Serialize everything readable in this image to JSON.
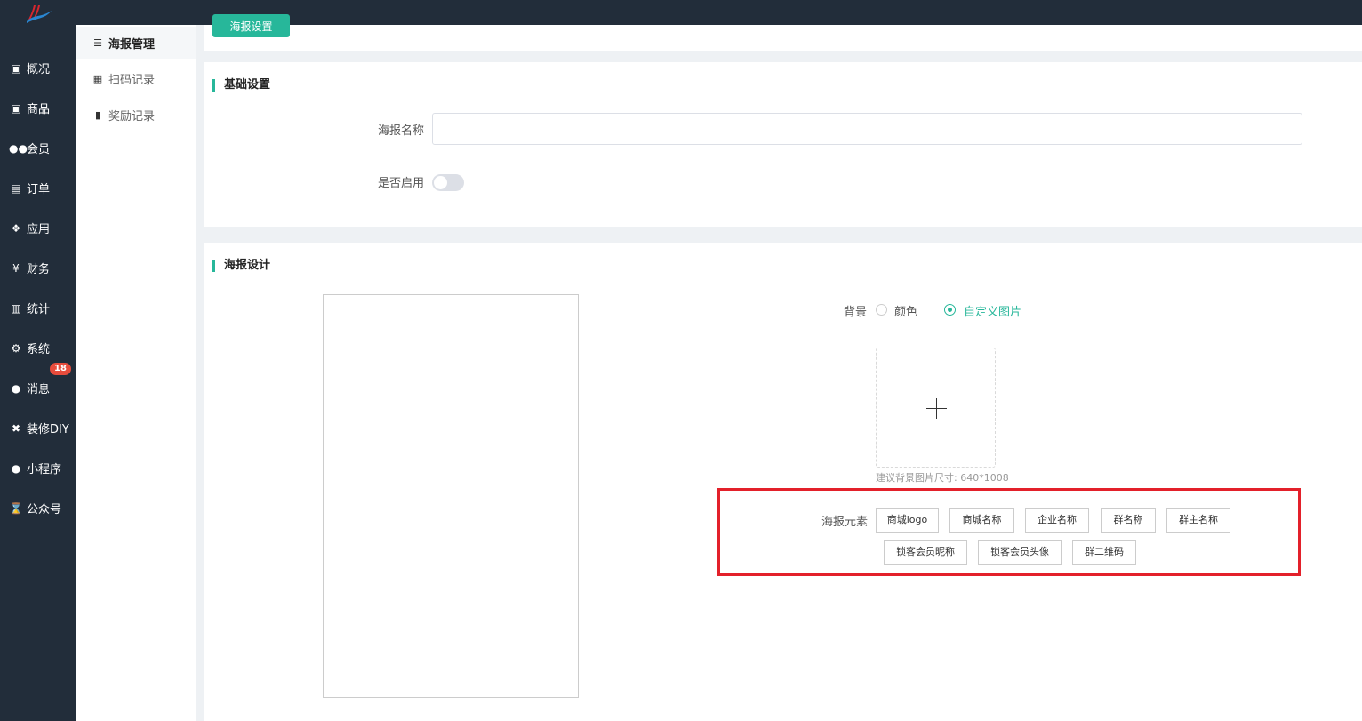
{
  "sidebar": {
    "items": [
      {
        "label": "概况",
        "icon": "archive-icon"
      },
      {
        "label": "商品",
        "icon": "archive-icon"
      },
      {
        "label": "会员",
        "icon": "users-icon"
      },
      {
        "label": "订单",
        "icon": "cart-icon"
      },
      {
        "label": "应用",
        "icon": "cubes-icon"
      },
      {
        "label": "财务",
        "icon": "yen-icon"
      },
      {
        "label": "统计",
        "icon": "bar-chart-icon"
      },
      {
        "label": "系统",
        "icon": "gears-icon"
      },
      {
        "label": "消息",
        "icon": "comment-icon",
        "badge": "18"
      },
      {
        "label": "装修DIY",
        "icon": "gavel-icon"
      },
      {
        "label": "小程序",
        "icon": "wechat-icon"
      },
      {
        "label": "公众号",
        "icon": "hourglass-icon"
      }
    ]
  },
  "subnav": {
    "items": [
      {
        "label": "海报管理",
        "icon": "list-icon",
        "active": true
      },
      {
        "label": "扫码记录",
        "icon": "qrcode-icon"
      },
      {
        "label": "奖励记录",
        "icon": "bookmark-icon"
      }
    ]
  },
  "top_button": "海报设置",
  "basic": {
    "title": "基础设置",
    "name_label": "海报名称",
    "name_value": "",
    "enable_label": "是否启用"
  },
  "design": {
    "title": "海报设计",
    "bg_label": "背景",
    "bg_options": [
      "颜色",
      "自定义图片"
    ],
    "bg_selected": "自定义图片",
    "upload_hint": "建议背景图片尺寸: 640*1008",
    "elements_label": "海报元素",
    "elements": [
      "商城logo",
      "商城名称",
      "企业名称",
      "群名称",
      "群主名称",
      "锁客会员昵称",
      "锁客会员头像",
      "群二维码"
    ]
  },
  "colors": {
    "sidebar_bg": "#222d3a",
    "accent": "#27b79a",
    "badge": "#e74c3c",
    "highlight_box": "#e3202a"
  }
}
